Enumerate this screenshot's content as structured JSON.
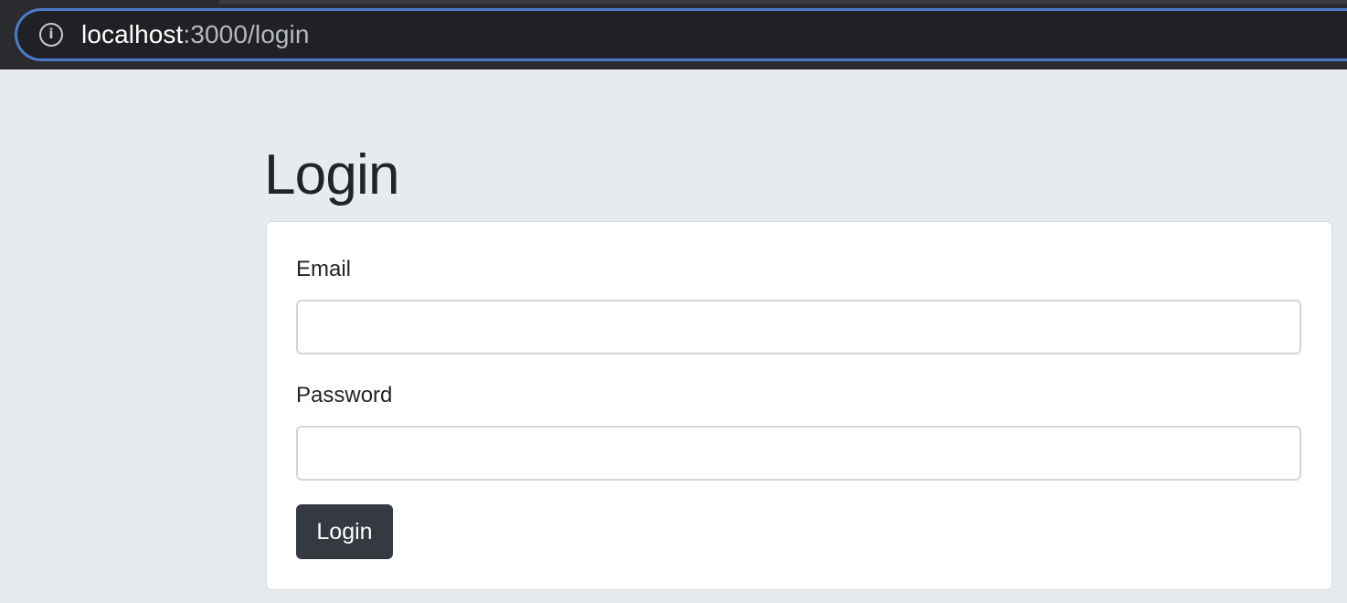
{
  "browser": {
    "url_host": "localhost",
    "url_rest": ":3000/login",
    "info_icon": "info-icon"
  },
  "page": {
    "title": "Login"
  },
  "form": {
    "email_label": "Email",
    "email_value": "",
    "password_label": "Password",
    "password_value": "",
    "submit_label": "Login"
  },
  "colors": {
    "page_background": "#e8ebee",
    "address_bar_accent": "#4b7cc9",
    "button_background": "#343a40"
  }
}
